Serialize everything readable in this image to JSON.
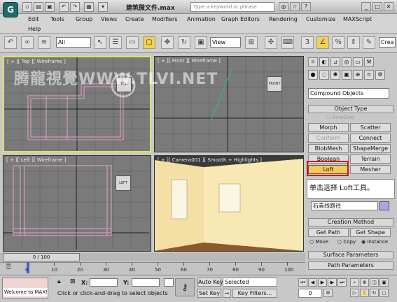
{
  "window": {
    "title": "建筑微文件.max",
    "search_placeholder": "Type a keyword or phrase",
    "app_icon": "3ds-max-logo",
    "quick_icons": [
      "new-icon",
      "open-icon",
      "save-icon",
      "undo-icon",
      "redo-icon",
      "hold-icon"
    ],
    "controls": [
      "_",
      "□",
      "✕"
    ]
  },
  "menu": {
    "items": [
      "Edit",
      "Tools",
      "Group",
      "Views",
      "Create",
      "Modifiers",
      "Animation",
      "Graph Editors",
      "Rendering",
      "Customize",
      "MAXScript",
      "Help"
    ]
  },
  "toolbar": {
    "selection_filter": "All",
    "ref_coord": "View",
    "named_set": "Crea"
  },
  "viewports": {
    "top": {
      "label": "[ + ][ Top ][ Wireframe ]",
      "cube": "TOP"
    },
    "front": {
      "label": "[ + ][ Front ][ Wireframe ]",
      "cube": "FRONT"
    },
    "left": {
      "label": "[ + ][ Left ][ Wireframe ]",
      "cube": "LEFT"
    },
    "camera": {
      "label": "[ + ][ Camera001 ][ Smooth + Highlights ]"
    }
  },
  "watermark": "腾龍視覺WWW.TLVI.NET",
  "command_panel": {
    "category_dropdown": "Compound Objects",
    "object_type_header": "Object Type",
    "autogrid_label": "AutoGrid",
    "buttons": [
      {
        "label": "Morph",
        "enabled": true
      },
      {
        "label": "Scatter",
        "enabled": true
      },
      {
        "label": "Conform",
        "enabled": false
      },
      {
        "label": "Connect",
        "enabled": true
      },
      {
        "label": "BlobMesh",
        "enabled": true
      },
      {
        "label": "ShapeMerge",
        "enabled": true
      },
      {
        "label": "Boolean",
        "enabled": true
      },
      {
        "label": "Terrain",
        "enabled": true
      },
      {
        "label": "Loft",
        "enabled": true
      },
      {
        "label": "Mesher",
        "enabled": true
      }
    ],
    "callout": "单击选择 Loft工具。",
    "object_name": "石青线路径",
    "creation_method_header": "Creation Method",
    "get_path": "Get Path",
    "get_shape": "Get Shape",
    "radio_options": [
      "Move",
      "Copy",
      "Instance"
    ],
    "radio_selected": "Instance",
    "surface_params_header": "Surface Parameters",
    "path_params_header": "Path Parameters",
    "highlight_color": "#d2121a"
  },
  "timeline": {
    "slider_label": "0 / 100",
    "ticks": [
      "0",
      "10",
      "20",
      "30",
      "40",
      "50",
      "60",
      "70",
      "80",
      "90",
      "100"
    ]
  },
  "status": {
    "welcome": "Welcome to MAX!",
    "x_label": "X:",
    "y_label": "Y:",
    "prompt": "Click or click-and-drag to select objects",
    "auto_key": "Auto Key",
    "set_key": "Set Key",
    "key_dropdown": "Selected",
    "key_filters": "Key Filters...",
    "frame": "0"
  }
}
